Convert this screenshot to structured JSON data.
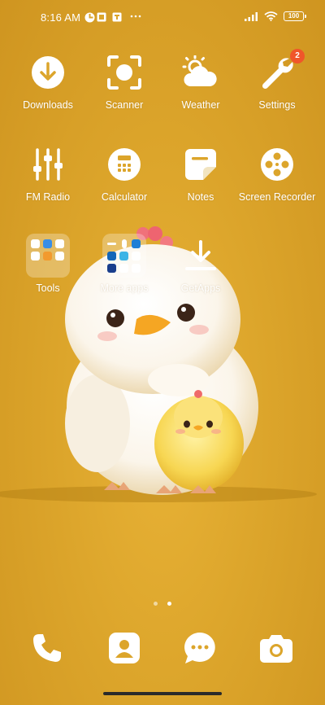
{
  "status_bar": {
    "time": "8:16 AM",
    "notification_icons": [
      "vpn-icon",
      "image-icon",
      "gallery-icon",
      "more-icon"
    ],
    "battery": "100"
  },
  "apps": {
    "downloads": {
      "label": "Downloads"
    },
    "scanner": {
      "label": "Scanner"
    },
    "weather": {
      "label": "Weather"
    },
    "settings": {
      "label": "Settings",
      "badge": "2"
    },
    "fm_radio": {
      "label": "FM Radio"
    },
    "calculator": {
      "label": "Calculator"
    },
    "notes": {
      "label": "Notes"
    },
    "screen_recorder": {
      "label": "Screen Recorder"
    },
    "tools": {
      "label": "Tools"
    },
    "more_apps": {
      "label": "More apps"
    },
    "getapps": {
      "label": "GetApps"
    }
  },
  "pager": {
    "pages": 2,
    "active": 2
  },
  "dock": [
    "phone",
    "contacts",
    "messages",
    "camera"
  ],
  "colors": {
    "background": "#dca52b",
    "badge": "#f0562a",
    "icon": "#ffffff"
  }
}
